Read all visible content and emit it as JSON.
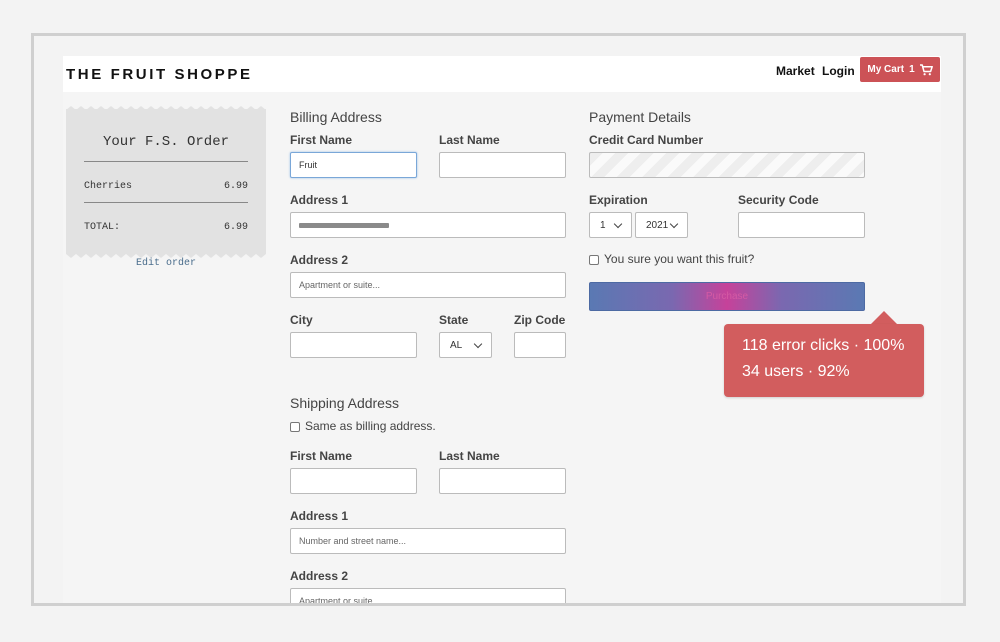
{
  "header": {
    "brand": "THE FRUIT SHOPPE",
    "nav": [
      "Market",
      "Login"
    ],
    "cart_label": "My Cart",
    "cart_count": "1"
  },
  "order": {
    "title": "Your F.S. Order",
    "items": [
      {
        "name": "Cherries",
        "price": "6.99"
      }
    ],
    "total_label": "TOTAL:",
    "total_value": "6.99",
    "edit_link": "Edit order"
  },
  "billing": {
    "heading": "Billing Address",
    "first_name_label": "First Name",
    "first_name_value": "Fruit",
    "last_name_label": "Last Name",
    "address1_label": "Address 1",
    "address2_label": "Address 2",
    "address2_placeholder": "Apartment or suite...",
    "city_label": "City",
    "state_label": "State",
    "state_value": "AL",
    "zip_label": "Zip Code"
  },
  "shipping": {
    "heading": "Shipping Address",
    "same_as_billing": "Same as billing address.",
    "first_name_label": "First Name",
    "last_name_label": "Last Name",
    "address1_label": "Address 1",
    "address1_placeholder": "Number and street name...",
    "address2_label": "Address 2",
    "address2_placeholder": "Apartment or suite..."
  },
  "payment": {
    "heading": "Payment Details",
    "cc_label": "Credit Card Number",
    "expiration_label": "Expiration",
    "month_value": "1",
    "year_value": "2021",
    "security_label": "Security Code",
    "confirm_text": "You sure you want this fruit?",
    "purchase_label": "Purchase"
  },
  "tooltip": {
    "line1": "118 error clicks · 100%",
    "line2": "34 users · 92%"
  },
  "colors": {
    "accent_red": "#cc5256",
    "tooltip_red": "#d25d5e",
    "link_blue": "#4a6d8c"
  }
}
